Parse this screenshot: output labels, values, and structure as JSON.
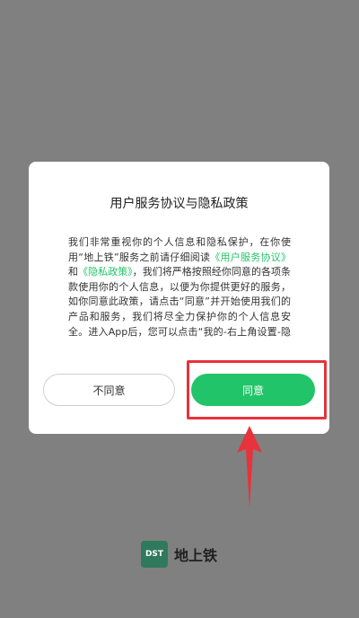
{
  "dialog": {
    "title": "用户服务协议与隐私政策",
    "body": {
      "p1": "我们非常重视你的个人信息和隐私保护，在你使用“地上铁”服务之前请仔细阅读",
      "link_service": "《用户服务协议》",
      "and": "和",
      "link_privacy": "《隐私政策》",
      "p2": "，我们将严格按照经你同意的各项条款使用你的个人信息，以便为你提供更好的服务，如你同意此政策，请点击“同意”并开始使用我们的产品和服务，我们将尽全力保护你的个人信息安全。进入App后，您可以点击“我的-右上角设置-隐私管理”，可查看隐私政策和用户协议"
    },
    "buttons": {
      "disagree": "不同意",
      "agree": "同意"
    }
  },
  "brand": {
    "logo_text": "DST",
    "name": "地上铁"
  },
  "colors": {
    "accent": "#21c468",
    "annotation": "#e8323c",
    "overlay": "#808080"
  }
}
